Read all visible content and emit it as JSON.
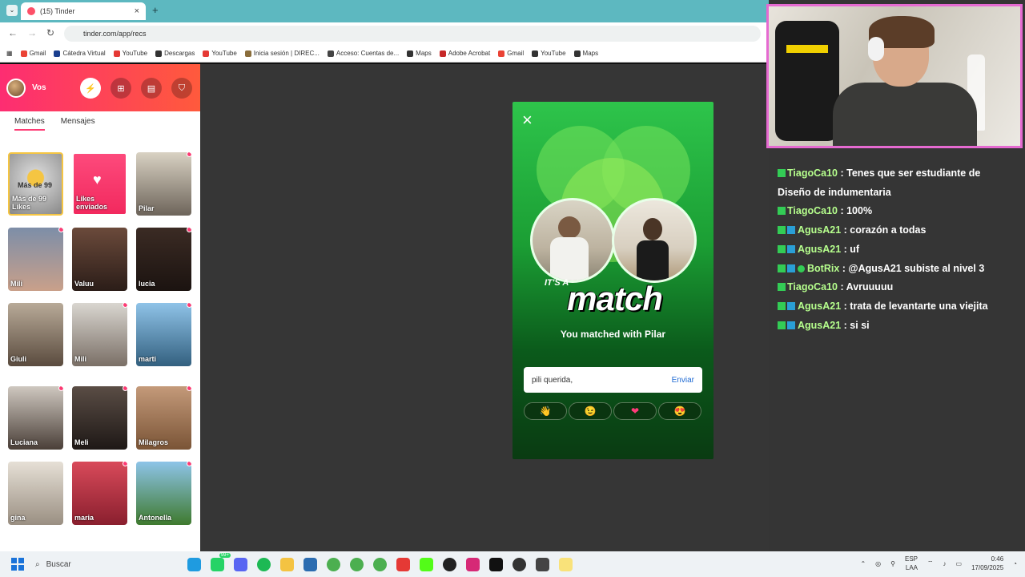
{
  "browser": {
    "tab_title": "(15) Tinder",
    "tab_close": "×",
    "new_tab": "+",
    "url": "tinder.com/app/recs",
    "bookmarks": [
      "Gmail",
      "Cátedra Virtual",
      "YouTube",
      "Descargas",
      "YouTube",
      "Inicia sesión | DIREC...",
      "Acceso: Cuentas de...",
      "Maps",
      "Adobe Acrobat",
      "Gmail",
      "YouTube",
      "Maps"
    ]
  },
  "sidebar": {
    "user_name": "Vos",
    "tabs": [
      "Matches",
      "Mensajes"
    ],
    "cards": [
      {
        "label": "Más de 99 Likes",
        "top_label": "Más de 99",
        "style": "likes"
      },
      {
        "label": "Likes enviados",
        "style": "sent"
      },
      {
        "label": "Pilar"
      },
      {
        "label": "Mili"
      },
      {
        "label": "Valuu"
      },
      {
        "label": "lucia"
      },
      {
        "label": "Giuli"
      },
      {
        "label": "Mili"
      },
      {
        "label": "marti"
      },
      {
        "label": "Luciana"
      },
      {
        "label": "Meli"
      },
      {
        "label": "Milagros"
      },
      {
        "label": "gina"
      },
      {
        "label": "maria"
      },
      {
        "label": "Antonella"
      }
    ]
  },
  "modal": {
    "close": "×",
    "its_a": "IT'S A",
    "match": "match",
    "matched_text": "You matched with Pilar",
    "message_value": "pili querida,",
    "send_label": "Enviar",
    "emojis": [
      "👋",
      "😉",
      "❤",
      "😍"
    ]
  },
  "chat": {
    "lines": [
      {
        "user": "TiagoCa10",
        "msg": "Tenes que ser estudiante de Diseño de indumentaria",
        "badges": 1
      },
      {
        "user": "TiagoCa10",
        "msg": "100%",
        "badges": 1
      },
      {
        "user": "AgusA21",
        "msg": "corazón a todas",
        "badges": 2
      },
      {
        "user": "AgusA21",
        "msg": "uf",
        "badges": 2
      },
      {
        "user": "BotRix",
        "msg": "@AgusA21 subiste al nivel 3",
        "badges": 3
      },
      {
        "user": "TiagoCa10",
        "msg": "Avruuuuu",
        "badges": 1
      },
      {
        "user": "AgusA21",
        "msg": "trata de levantarte una viejita",
        "badges": 2
      },
      {
        "user": "AgusA21",
        "msg": "si si",
        "badges": 2
      }
    ]
  },
  "taskbar": {
    "search_placeholder": "Buscar",
    "lang_top": "ESP",
    "lang_bottom": "LAA",
    "time": "0:46",
    "date": "17/09/2025",
    "notif_badge": "99+"
  },
  "colors": {
    "tinder_pink": "#fd2d72",
    "match_green": "#2ec44b",
    "chat_user": "#b6ff8d"
  }
}
